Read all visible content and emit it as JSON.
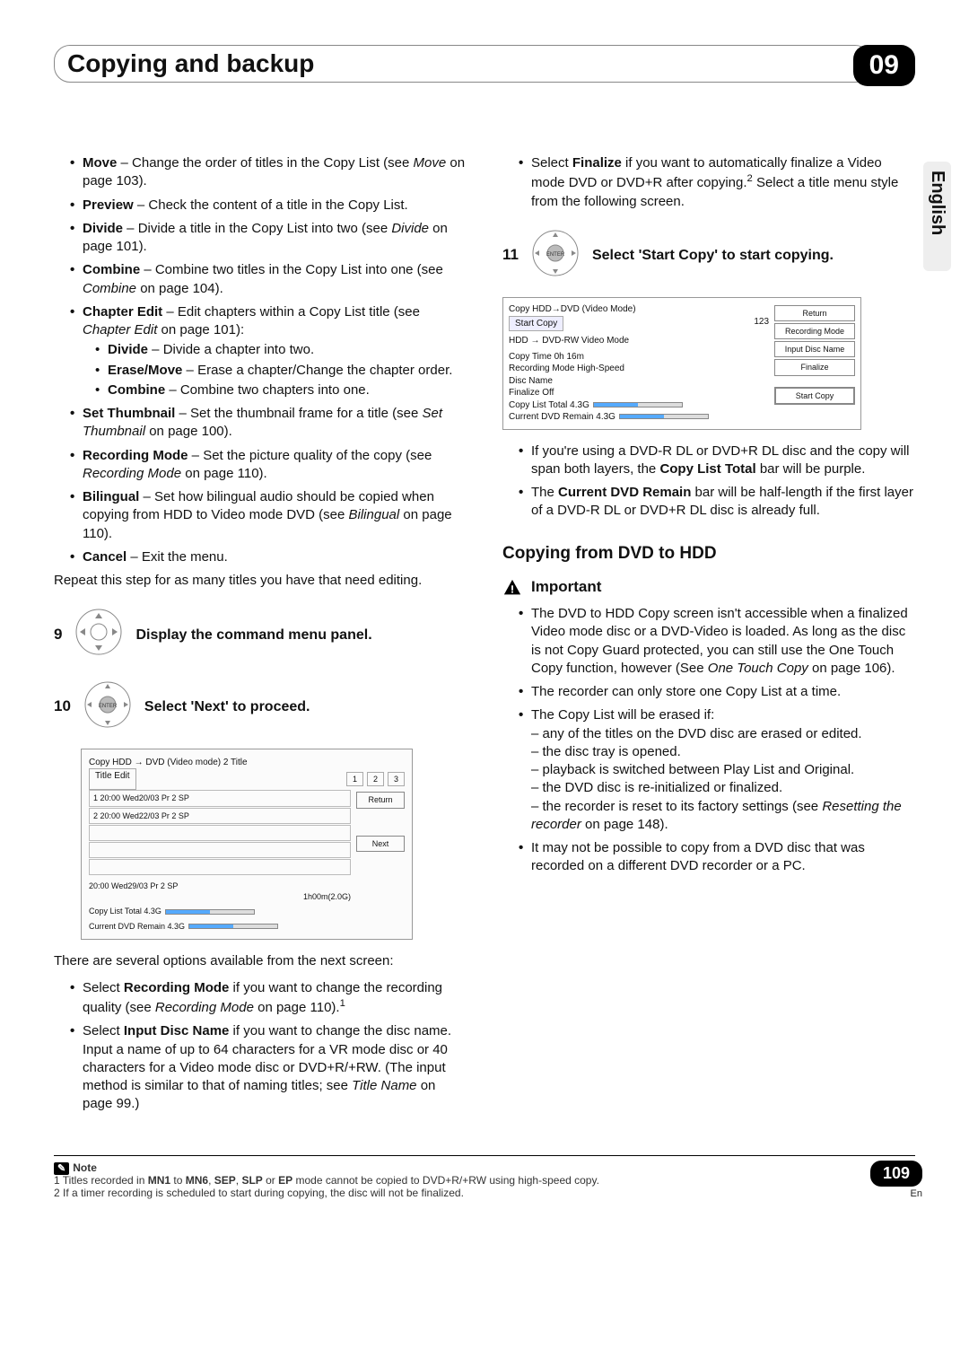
{
  "header": {
    "title": "Copying and backup",
    "chapter_num": "09"
  },
  "side_tab": "English",
  "left": {
    "items": {
      "move": {
        "label": "Move",
        "text": " – Change the order of titles in the Copy List (see ",
        "ref": "Move",
        "after": " on page 103)."
      },
      "preview": {
        "label": "Preview",
        "text": " – Check the content of a title in the Copy List."
      },
      "divide": {
        "label": "Divide",
        "text": " – Divide a title in the Copy List into two (see ",
        "ref": "Divide",
        "after": " on page 101)."
      },
      "combine": {
        "label": "Combine",
        "text": " – Combine two titles in the Copy List into one (see ",
        "ref": "Combine",
        "after": " on page 104)."
      },
      "chapter": {
        "label": "Chapter Edit",
        "text": " – Edit chapters within a Copy List title (see ",
        "ref": "Chapter Edit",
        "after": " on page 101):"
      },
      "sub_divide": {
        "label": "Divide",
        "text": " – Divide a chapter into two."
      },
      "sub_erase": {
        "label": "Erase/Move",
        "text": " – Erase a chapter/Change the chapter order."
      },
      "sub_combine": {
        "label": "Combine",
        "text": " – Combine two chapters into one."
      },
      "thumb": {
        "label": "Set Thumbnail",
        "text": " – Set the thumbnail frame for a title (see ",
        "ref": "Set Thumbnail",
        "after": " on page 100)."
      },
      "recmode": {
        "label": "Recording Mode",
        "text": " – Set the picture quality of the copy (see ",
        "ref": "Recording Mode",
        "after": " on page 110)."
      },
      "biling": {
        "label": "Bilingual",
        "text": " – Set how bilingual audio should be copied when copying from HDD to Video mode DVD (see ",
        "ref": "Bilingual",
        "after": " on page 110)."
      },
      "cancel": {
        "label": "Cancel",
        "text": " – Exit the menu."
      }
    },
    "repeat": "Repeat this step for as many titles you have that need editing.",
    "step9": {
      "num": "9",
      "label": "Display the command menu panel."
    },
    "step10": {
      "num": "10",
      "label": "Select 'Next' to proceed."
    },
    "ui1": {
      "title": "Copy        HDD → DVD (Video mode)                2  Title",
      "tab": "Title Edit",
      "pages": [
        "1",
        "2",
        "3"
      ],
      "row1": "1    20:00  Wed20/03  Pr 2   SP",
      "row2": "2    20:00  Wed22/03  Pr 2   SP",
      "btn_return": "Return",
      "btn_next": "Next",
      "detail": "20:00   Wed29/03   Pr 2   SP",
      "dur": "1h00m(2.0G)",
      "f1": "Copy List Total            4.3G",
      "f2": "Current DVD Remain   4.3G"
    },
    "next_options": "There are several options available from the next screen:",
    "opt_recmode_a": "Select ",
    "opt_recmode_b": "Recording Mode",
    "opt_recmode_c": " if you want to change the recording quality (see ",
    "opt_recmode_ref": "Recording Mode",
    "opt_recmode_d": " on page 110).",
    "sup1": "1",
    "opt_disc_a": "Select ",
    "opt_disc_b": "Input Disc Name",
    "opt_disc_c": " if you want to change the disc name. Input a name of up to 64 characters for a VR mode disc or 40 characters for a Video mode disc or DVD+R/+RW. (The input method is similar to that of naming titles; see ",
    "opt_disc_ref": "Title Name",
    "opt_disc_d": " on page 99.)"
  },
  "right": {
    "finalize_a": "Select ",
    "finalize_b": "Finalize",
    "finalize_c": " if you want to automatically finalize a Video mode DVD or DVD+R after copying.",
    "sup2": "2",
    "finalize_d": " Select a title menu style from the following screen.",
    "step11": {
      "num": "11",
      "label": "Select 'Start Copy' to start copying."
    },
    "ui2": {
      "title": "Copy        HDD→DVD (Video Mode)",
      "tab": "Start Copy",
      "pages": [
        "1",
        "2",
        "3"
      ],
      "line_hdd": "HDD   →   DVD-RW Video Mode",
      "line_time": "Copy Time    0h 16m",
      "line_recmode": "Recording Mode     High-Speed",
      "line_discname": "Disc Name",
      "line_finalize": "Finalize                 Off",
      "f1": "Copy List Total            4.3G",
      "f2": "Current DVD Remain   4.3G",
      "side": {
        "r1": "Return",
        "r2": "Recording Mode",
        "r3": "Input Disc Name",
        "r4": "Finalize",
        "r5": "Start Copy"
      }
    },
    "dl_a": "If you're using a DVD-R DL or DVD+R DL disc and the copy will span both layers, the ",
    "dl_b": "Copy List Total",
    "dl_c": " bar will be purple.",
    "remain_a": "The ",
    "remain_b": "Current DVD Remain",
    "remain_c": " bar will be half-length if the first layer of a DVD-R DL or DVD+R DL disc is already full.",
    "section": "Copying from DVD to HDD",
    "important": "Important",
    "imp1_a": "The DVD to HDD Copy screen isn't accessible when a finalized Video mode disc or a DVD-Video is loaded. As long as the disc is not Copy Guard protected, you can still use the One Touch Copy function, however (See ",
    "imp1_ref": "One Touch Copy",
    "imp1_b": " on page 106).",
    "imp2": "The recorder can only store one Copy List at a time.",
    "imp3": "The Copy List will be erased if:",
    "imp3_a": "– any of the titles on the DVD disc are erased or edited.",
    "imp3_b": "– the disc tray is opened.",
    "imp3_c": "– playback is switched between Play List and Original.",
    "imp3_d": "– the DVD disc is re-initialized or finalized.",
    "imp3_e_a": "– the recorder is reset to its factory settings (see ",
    "imp3_e_ref": "Resetting the recorder",
    "imp3_e_b": " on page 148).",
    "imp4": "It may not be possible to copy from a DVD disc that was recorded on a different DVD recorder or a PC."
  },
  "notes": {
    "label": "Note",
    "n1_a": "1 Titles recorded in ",
    "n1_b": "MN1",
    "n1_c": " to ",
    "n1_d": "MN6",
    "n1_e": ", ",
    "n1_f": "SEP",
    "n1_g": ", ",
    "n1_h": "SLP",
    "n1_i": " or ",
    "n1_j": "EP",
    "n1_k": " mode cannot be copied to DVD+R/+RW using high-speed copy.",
    "n2": "2 If a timer recording is scheduled to start during copying, the disc will not be finalized."
  },
  "footer": {
    "page": "109",
    "lang": "En"
  }
}
